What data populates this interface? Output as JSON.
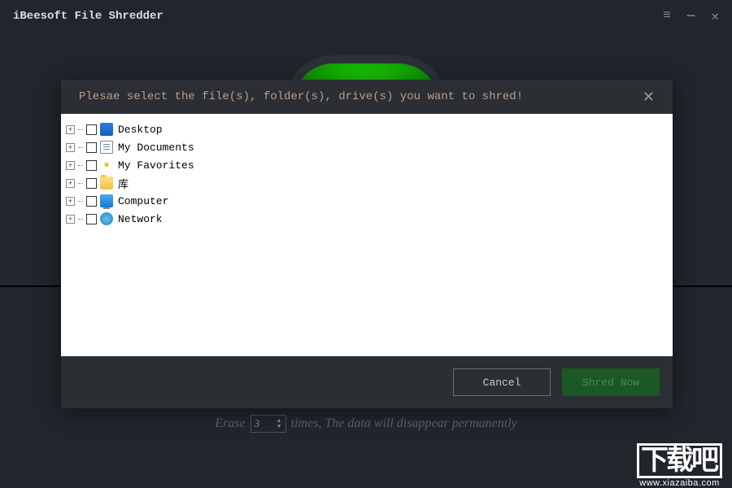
{
  "titlebar": {
    "title": "iBeesoft File Shredder"
  },
  "erase": {
    "prefix": "Erase",
    "value": "3",
    "suffix": "times, The data will disappear permanently"
  },
  "modal": {
    "title": "Plesae select the file(s), folder(s), drive(s) you want to shred!",
    "tree": [
      {
        "label": "Desktop",
        "icon": "desktop-icon"
      },
      {
        "label": "My Documents",
        "icon": "document-icon"
      },
      {
        "label": "My Favorites",
        "icon": "star-icon"
      },
      {
        "label": "库",
        "icon": "folder-icon"
      },
      {
        "label": "Computer",
        "icon": "computer-icon"
      },
      {
        "label": "Network",
        "icon": "network-icon"
      }
    ],
    "cancel_label": "Cancel",
    "shred_label": "Shred Now"
  },
  "watermark": {
    "big": "下载吧",
    "url": "www.xiazaiba.com"
  }
}
